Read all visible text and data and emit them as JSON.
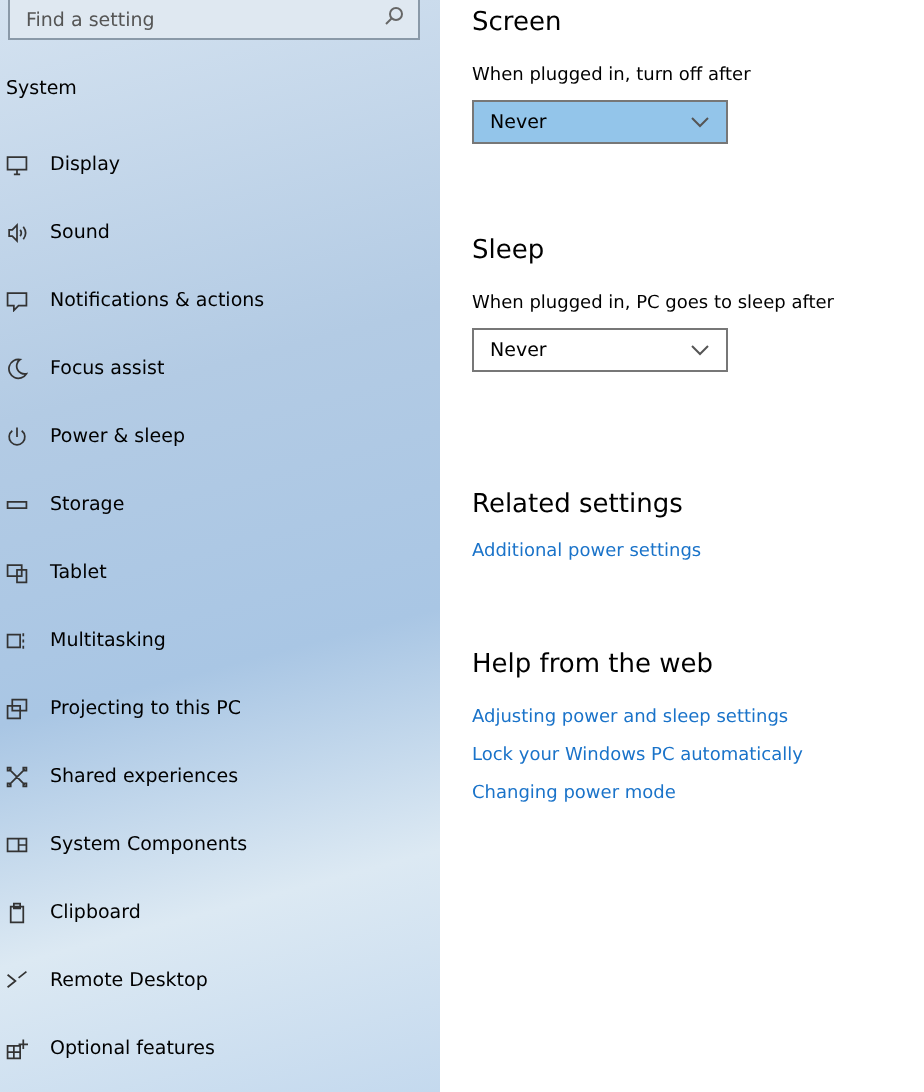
{
  "sidebar": {
    "search": {
      "placeholder": "Find a setting"
    },
    "header": "System",
    "items": [
      {
        "label": "Display",
        "selected": false
      },
      {
        "label": "Sound",
        "selected": false
      },
      {
        "label": "Notifications & actions",
        "selected": false
      },
      {
        "label": "Focus assist",
        "selected": false
      },
      {
        "label": "Power & sleep",
        "selected": false
      },
      {
        "label": "Storage",
        "selected": false
      },
      {
        "label": "Tablet",
        "selected": false
      },
      {
        "label": "Multitasking",
        "selected": false
      },
      {
        "label": "Projecting to this PC",
        "selected": false
      },
      {
        "label": "Shared experiences",
        "selected": false
      },
      {
        "label": "System Components",
        "selected": false
      },
      {
        "label": "Clipboard",
        "selected": false
      },
      {
        "label": "Remote Desktop",
        "selected": false
      },
      {
        "label": "Optional features",
        "selected": false
      }
    ]
  },
  "sections": [
    {
      "title": "Screen",
      "label": "When plugged in, turn off after",
      "dropdown": {
        "value": "Never",
        "focused": true
      }
    },
    {
      "title": "Sleep",
      "label": "When plugged in, PC goes to sleep after",
      "dropdown": {
        "value": "Never",
        "focused": false
      }
    }
  ],
  "related_settings": {
    "title": "Related settings",
    "links": [
      "Additional power settings"
    ]
  },
  "help": {
    "title": "Help from the web",
    "links": [
      "Adjusting power and sleep settings",
      "Lock your Windows PC automatically",
      "Changing power mode"
    ]
  }
}
